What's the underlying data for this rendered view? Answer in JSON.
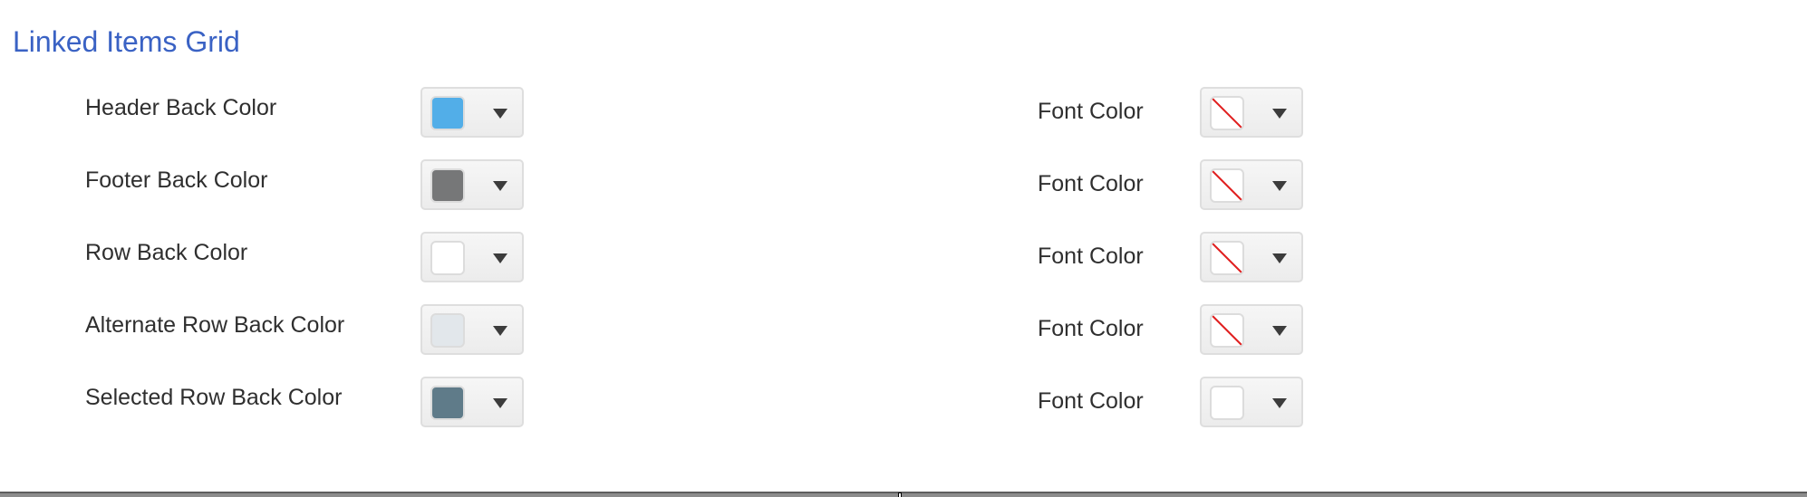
{
  "section": {
    "title": "Linked Items Grid"
  },
  "rows": [
    {
      "back_label": "Header Back Color",
      "back_color": "#52aee8",
      "back_none": false,
      "font_label": "Font Color",
      "font_color": "none",
      "font_none": true
    },
    {
      "back_label": "Footer Back Color",
      "back_color": "#767778",
      "back_none": false,
      "font_label": "Font Color",
      "font_color": "none",
      "font_none": true
    },
    {
      "back_label": "Row Back Color",
      "back_color": "#ffffff",
      "back_none": false,
      "font_label": "Font Color",
      "font_color": "none",
      "font_none": true
    },
    {
      "back_label": "Alternate Row Back Color",
      "back_color": "#e2e7eb",
      "back_none": false,
      "font_label": "Font Color",
      "font_color": "none",
      "font_none": true
    },
    {
      "back_label": "Selected Row Back Color",
      "back_color": "#5f7b89",
      "back_none": false,
      "font_label": "Font Color",
      "font_color": "#ffffff",
      "font_none": false
    }
  ],
  "icons": {
    "dropdown": "caret-down-icon",
    "no_color": "no-color-slash-icon"
  },
  "colors": {
    "title": "#3a62c4",
    "no_color_slash": "#e02020"
  }
}
